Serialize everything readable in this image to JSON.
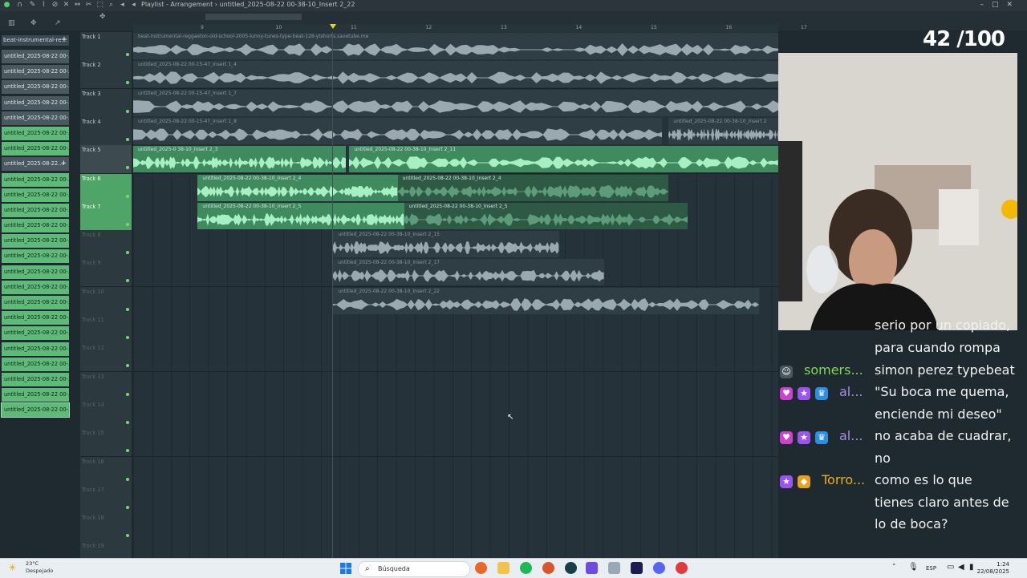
{
  "window": {
    "title": "Playlist - Arrangement",
    "separator": "›",
    "pattern": "untitled_2025-08-22 00-38-10_Insert 2_22"
  },
  "picker": {
    "header": "beat-instrumental-re...",
    "add_symbol": "+",
    "items": [
      "untitled_2025-08-22 00-...",
      "untitled_2025-08-22 00-...",
      "untitled_2025-08-22 00-...",
      "untitled_2025-08-22 00-...",
      "untitled_2025-08-22 00-...",
      "untitled_2025-08-22 00-...",
      "untitled_2025-08-22 00-...",
      "untitled_2025-08-22...",
      "untitled_2025-08-22 00-...",
      "untitled_2025-08-22 00-...",
      "untitled_2025-08-22 00-...",
      "untitled_2025-08-22 00-...",
      "untitled_2025-08-22 00-...",
      "untitled_2025-08-22 00-...",
      "untitled_2025-08-22 00-...",
      "untitled_2025-08-22 00-...",
      "untitled_2025-08-22 00-...",
      "untitled_2025-08-22 00-...",
      "untitled_2025-08-22 00-...",
      "untitled_2025-08-22 00-...",
      "untitled_2025-08-22 00-...",
      "untitled_2025-08-22 00-...",
      "untitled_2025-08-22 00-...",
      "untitled_2025-08-22 00-..."
    ]
  },
  "ruler": {
    "bars": [
      "9",
      "10",
      "11",
      "12",
      "13",
      "14",
      "15",
      "16",
      "17"
    ]
  },
  "tracks": [
    {
      "name": "Track 1",
      "state": "normal",
      "clips": [
        {
          "label": "beat-instrumental-reggaeton-old-school-2005-lunny-tunes-type-beat-128-ytshorts.savetube.me",
          "style": "grey",
          "start": 0,
          "end": 1
        }
      ]
    },
    {
      "name": "Track 2",
      "state": "normal",
      "clips": [
        {
          "label": "untitled_2025-08-22 00-15-47_Insert 1_4",
          "style": "grey",
          "start": 0,
          "end": 1
        }
      ]
    },
    {
      "name": "Track 3",
      "state": "normal",
      "clips": [
        {
          "label": "untitled_2025-08-22 00-15-47_Insert 1_7",
          "style": "grey",
          "start": 0,
          "end": 1
        }
      ]
    },
    {
      "name": "Track 4",
      "state": "normal",
      "clips": [
        {
          "label": "untitled_2025-08-22 00-15-47_Insert 1_8",
          "style": "grey",
          "start": 0,
          "end": 0.82
        },
        {
          "label": "untitled_2025-08-22 00-38-10_Insert 2",
          "style": "grey",
          "start": 0.83,
          "end": 1
        }
      ]
    },
    {
      "name": "Track 5",
      "state": "selected",
      "clips": [
        {
          "label": "untitled_2025-0 38-10_Insert 2_3",
          "style": "green",
          "start": 0,
          "end": 0.33
        },
        {
          "label": "untitled_2025-08-22 00-38-10_Insert 2_11",
          "style": "green",
          "start": 0.335,
          "end": 1
        }
      ]
    },
    {
      "name": "Track 6",
      "state": "on",
      "clips": [
        {
          "label": "untitled_2025-08-22 00-38-10_Insert 2_4",
          "style": "green",
          "start": 0.1,
          "end": 0.41
        },
        {
          "label": "untitled_2025-08-22 00-38-10_Insert 2_4",
          "style": "gfaint",
          "start": 0.41,
          "end": 0.83
        }
      ]
    },
    {
      "name": "Track 7",
      "state": "on",
      "clips": [
        {
          "label": "untitled_2025-08-22 00-38-10_Insert 2_5",
          "style": "green",
          "start": 0.1,
          "end": 0.42
        },
        {
          "label": "untitled_2025-08-22 00-38-10_Insert 2_5",
          "style": "gfaint",
          "start": 0.42,
          "end": 0.86
        }
      ]
    },
    {
      "name": "Track 8",
      "state": "dim",
      "clips": [
        {
          "label": "untitled_2025-08-22 00-38-10_Insert 2_15",
          "style": "grey",
          "start": 0.31,
          "end": 0.66
        }
      ]
    },
    {
      "name": "Track 9",
      "state": "dim",
      "clips": [
        {
          "label": "untitled_2025-08-22 00-38-10_Insert 2_17",
          "style": "grey",
          "start": 0.31,
          "end": 0.73
        }
      ]
    },
    {
      "name": "Track 10",
      "state": "dim",
      "clips": [
        {
          "label": "untitled_2025-08-22 00-38-10_Insert 2_22",
          "style": "grey",
          "start": 0.31,
          "end": 0.97
        }
      ]
    },
    {
      "name": "Track 11",
      "state": "dim",
      "clips": []
    },
    {
      "name": "Track 12",
      "state": "dim",
      "clips": []
    },
    {
      "name": "Track 13",
      "state": "dim",
      "clips": []
    },
    {
      "name": "Track 14",
      "state": "dim",
      "clips": []
    },
    {
      "name": "Track 15",
      "state": "dim",
      "clips": []
    },
    {
      "name": "Track 16",
      "state": "dim",
      "clips": []
    },
    {
      "name": "Track 17",
      "state": "dim",
      "clips": []
    },
    {
      "name": "Track 18",
      "state": "dim",
      "clips": []
    },
    {
      "name": "Track 19",
      "state": "dim",
      "clips": []
    }
  ],
  "overlay": {
    "counter": "42 /100"
  },
  "chat": {
    "partial_line": "serio por un copiado,",
    "messages": [
      {
        "user": "",
        "user_color": "#ffffff",
        "badges": [],
        "lines": [
          "para cuando rompa"
        ]
      },
      {
        "user": "somers...",
        "user_color": "#7ed957",
        "badges": [
          "avatar"
        ],
        "lines": [
          "simon perez typebeat"
        ]
      },
      {
        "user": "al...",
        "user_color": "#a98be0",
        "badges": [
          "heart",
          "star",
          "crown"
        ],
        "lines": [
          "\"Su boca me quema,",
          "enciende mi deseo\""
        ]
      },
      {
        "user": "al...",
        "user_color": "#a98be0",
        "badges": [
          "heart",
          "star",
          "crown"
        ],
        "lines": [
          "no acaba de cuadrar,",
          "no"
        ]
      },
      {
        "user": "Torro...",
        "user_color": "#e7b020",
        "badges": [
          "star",
          "gem"
        ],
        "lines": [
          "como es lo que",
          "tienes claro antes de",
          "lo de boca?"
        ]
      }
    ]
  },
  "taskbar": {
    "weather_temp": "23°C",
    "weather_desc": "Despejado",
    "search_placeholder": "Búsqueda",
    "lang": "ESP",
    "time": "1:24",
    "date": "22/08/2025"
  }
}
